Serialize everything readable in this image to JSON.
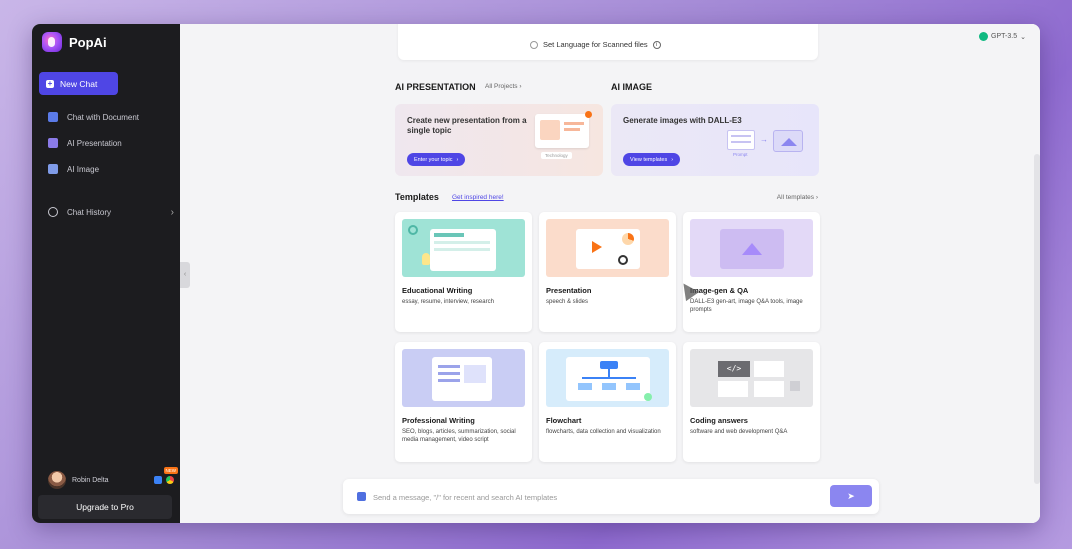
{
  "sidebar": {
    "brand": "PopAi",
    "new_chat": "New Chat",
    "items": [
      {
        "label": "Chat with Document",
        "icon": "document-icon"
      },
      {
        "label": "AI Presentation",
        "icon": "presentation-icon"
      },
      {
        "label": "AI Image",
        "icon": "image-icon"
      }
    ],
    "history": {
      "label": "Chat History",
      "icon": "history-icon"
    },
    "user": {
      "name": "Robin Delta",
      "badge": "NEW"
    },
    "upgrade": "Upgrade to Pro"
  },
  "header": {
    "model": "GPT-3.5"
  },
  "scanned": {
    "label": "Set Language for Scanned files"
  },
  "ai_presentation": {
    "title": "AI PRESENTATION",
    "link": "All Projects",
    "promo_text": "Create new presentation from a single topic",
    "button": "Enter your topic",
    "thumb_tag": "Technology"
  },
  "ai_image": {
    "title": "AI IMAGE",
    "promo_text": "Generate images with DALL-E3",
    "button": "View templates",
    "thumb_tag": "Prompt"
  },
  "templates": {
    "title": "Templates",
    "inspired": "Get inspired here!",
    "all": "All templates",
    "cards": [
      {
        "title": "Educational Writing",
        "desc": "essay, resume, interview, research"
      },
      {
        "title": "Presentation",
        "desc": "speech & slides"
      },
      {
        "title": "Image-gen & QA",
        "desc": "DALL-E3 gen-art, image Q&A tools, image prompts"
      },
      {
        "title": "Professional Writing",
        "desc": "SEO, blogs, articles, summarization, social media management, video script"
      },
      {
        "title": "Flowchart",
        "desc": "flowcharts, data collection and visualization"
      },
      {
        "title": "Coding answers",
        "desc": "software and web development Q&A"
      }
    ]
  },
  "chat": {
    "placeholder": "Send a message, \"/\" for recent and search AI templates"
  },
  "colors": {
    "accent": "#4f46e5",
    "sidebar": "#1c1c1f",
    "send": "#8b86f0"
  }
}
